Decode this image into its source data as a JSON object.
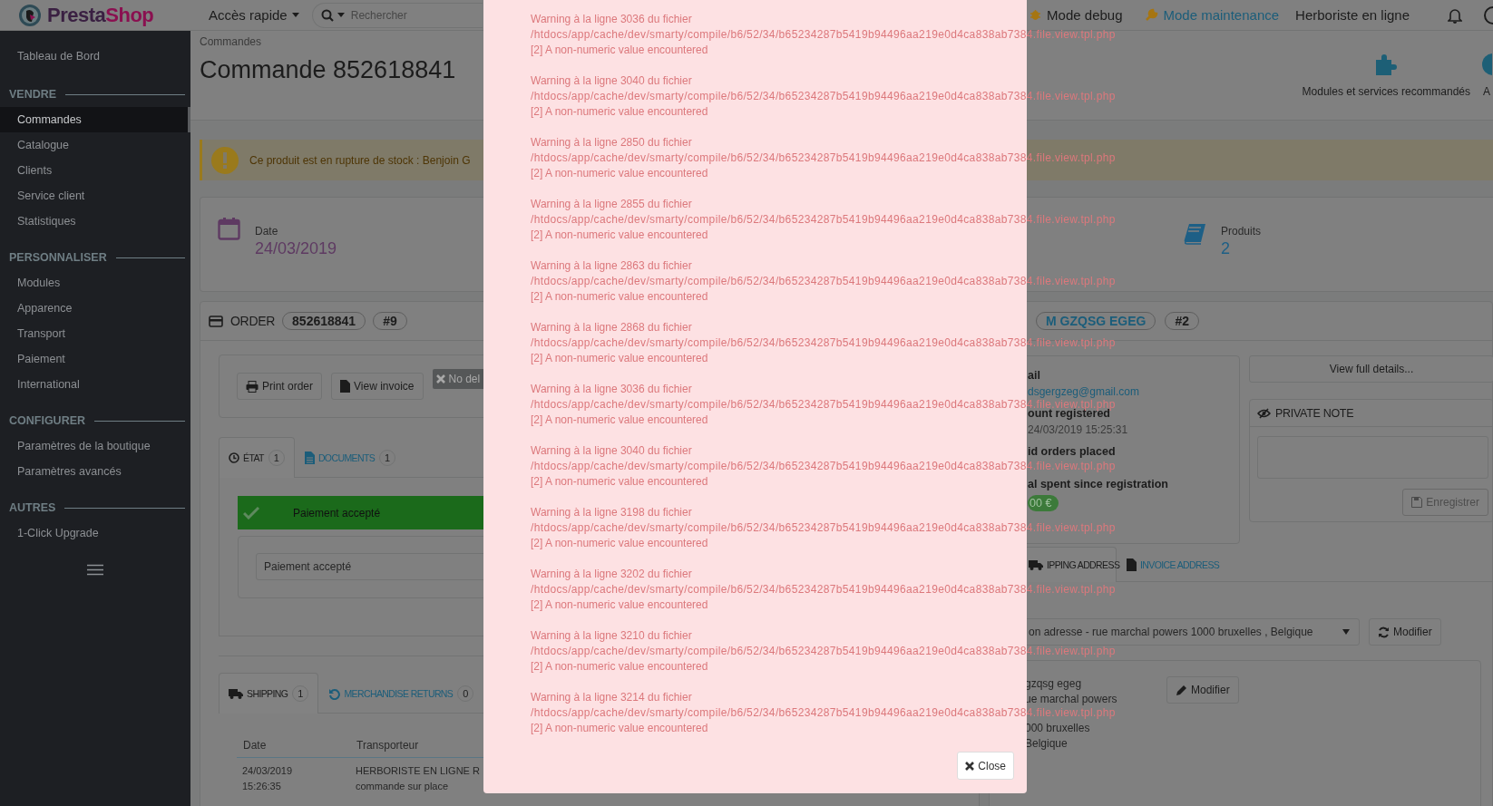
{
  "header": {
    "logo": [
      "Presta",
      "Shop"
    ],
    "quick_access": "Accès rapide",
    "search": {
      "placeholder": "Rechercher"
    },
    "debug": "Mode debug",
    "maintenance": "Mode maintenance",
    "shop": "Herboriste en ligne"
  },
  "sidebar": {
    "top_item": {
      "label": "Tableau de Bord",
      "selected": false
    },
    "sections": [
      {
        "title": "VENDRE",
        "items": [
          {
            "label": "Commandes",
            "selected": true
          },
          {
            "label": "Catalogue",
            "selected": false
          },
          {
            "label": "Clients",
            "selected": false
          },
          {
            "label": "Service client",
            "selected": false
          },
          {
            "label": "Statistiques",
            "selected": false
          }
        ]
      },
      {
        "title": "PERSONNALISER",
        "items": [
          {
            "label": "Modules",
            "selected": false
          },
          {
            "label": "Apparence",
            "selected": false
          },
          {
            "label": "Transport",
            "selected": false
          },
          {
            "label": "Paiement",
            "selected": false
          },
          {
            "label": "International",
            "selected": false
          }
        ]
      },
      {
        "title": "CONFIGURER",
        "items": [
          {
            "label": "Paramètres de la boutique",
            "selected": false
          },
          {
            "label": "Paramètres avancés",
            "selected": false
          }
        ]
      },
      {
        "title": "AUTRES",
        "items": [
          {
            "label": "1-Click Upgrade",
            "selected": false
          }
        ]
      }
    ]
  },
  "breadcrumb": "Commandes",
  "page_title": "Commande 852618841",
  "toolbar": {
    "action": "Modules et services recommandés",
    "action_2": "A"
  },
  "alert": "Ce produit est en rupture de stock : Benjoin G",
  "kpis": [
    {
      "kind": "date",
      "label": "Date",
      "value": "24/03/2019"
    },
    {
      "kind": "products",
      "label": "Produits",
      "value": "2"
    }
  ],
  "order_panel": {
    "title": "ORDER",
    "reference": "852618841",
    "number": "#9",
    "buttons": [
      {
        "kind": "print",
        "label": "Print order"
      },
      {
        "kind": "invoice",
        "label": "View invoice"
      },
      {
        "kind": "none",
        "label": "No del"
      }
    ],
    "status_tabs": [
      {
        "kind": "history",
        "label": "ÉTAT",
        "count": "1",
        "selected": true
      },
      {
        "kind": "documents",
        "label": "DOCUMENTS",
        "count": "1",
        "selected": false
      }
    ],
    "current_status": "Paiement accepté",
    "status_select": {
      "value": "Paiement accepté"
    },
    "shipping_tabs": [
      {
        "kind": "shipping",
        "label": "SHIPPING",
        "count": "1",
        "selected": true
      },
      {
        "kind": "returns",
        "label": "MERCHANDISE RETURNS",
        "count": "0",
        "selected": false
      }
    ],
    "shipping_table": {
      "columns": [
        "Date",
        "Transporteur"
      ],
      "rows": [
        [
          [
            "24/03/2019",
            "15:26:35"
          ],
          [
            "HERBORISTE EN LIGNE R",
            "commande sur place"
          ]
        ]
      ]
    }
  },
  "customer_panel": {
    "name": "M GZQSG EGEG",
    "number": "#2",
    "info": [
      {
        "kind": "link",
        "label": "ail",
        "value": "dsgergzeg@gmail.com"
      },
      {
        "kind": "text",
        "label": "ount registered",
        "value": "24/03/2019 15:25:31"
      },
      {
        "kind": "none",
        "label": "id orders placed"
      },
      {
        "kind": "badge",
        "label": "al spent since registration",
        "value": "00 €"
      }
    ],
    "details_button": "View full details...",
    "private_note": {
      "title": "PRIVATE NOTE",
      "save_button": {
        "label": "Enregistrer",
        "disabled": true
      }
    },
    "address_tabs": [
      {
        "kind": "shipping",
        "label": "IPPING ADDRESS",
        "selected": true
      },
      {
        "kind": "invoice",
        "label": "INVOICE ADDRESS",
        "selected": false
      }
    ],
    "address_select": {
      "value": "on adresse - rue marchal powers 1000 bruxelles , Belgique"
    },
    "refresh_button": "Modifier",
    "address_lines": [
      "gzqsg egeg",
      "ue marchal powers",
      "000 bruxelles",
      "Belgique"
    ],
    "edit_button": "Modifier"
  },
  "modal": {
    "warnings": [
      {
        "heading": "Warning à la ligne 3036 du fichier",
        "path": "/htdocs/app/cache/dev/smarty/compile/b6/52/34/b65234287b5419b94496aa219e0d4ca838ab7384.file.view.tpl.php",
        "message": "[2] A non-numeric value encountered"
      },
      {
        "heading": "Warning à la ligne 3040 du fichier",
        "path": "/htdocs/app/cache/dev/smarty/compile/b6/52/34/b65234287b5419b94496aa219e0d4ca838ab7384.file.view.tpl.php",
        "message": "[2] A non-numeric value encountered"
      },
      {
        "heading": "Warning à la ligne 2850 du fichier",
        "path": "/htdocs/app/cache/dev/smarty/compile/b6/52/34/b65234287b5419b94496aa219e0d4ca838ab7384.file.view.tpl.php",
        "message": "[2] A non-numeric value encountered"
      },
      {
        "heading": "Warning à la ligne 2855 du fichier",
        "path": "/htdocs/app/cache/dev/smarty/compile/b6/52/34/b65234287b5419b94496aa219e0d4ca838ab7384.file.view.tpl.php",
        "message": "[2] A non-numeric value encountered"
      },
      {
        "heading": "Warning à la ligne 2863 du fichier",
        "path": "/htdocs/app/cache/dev/smarty/compile/b6/52/34/b65234287b5419b94496aa219e0d4ca838ab7384.file.view.tpl.php",
        "message": "[2] A non-numeric value encountered"
      },
      {
        "heading": "Warning à la ligne 2868 du fichier",
        "path": "/htdocs/app/cache/dev/smarty/compile/b6/52/34/b65234287b5419b94496aa219e0d4ca838ab7384.file.view.tpl.php",
        "message": "[2] A non-numeric value encountered"
      },
      {
        "heading": "Warning à la ligne 3036 du fichier",
        "path": "/htdocs/app/cache/dev/smarty/compile/b6/52/34/b65234287b5419b94496aa219e0d4ca838ab7384.file.view.tpl.php",
        "message": "[2] A non-numeric value encountered"
      },
      {
        "heading": "Warning à la ligne 3040 du fichier",
        "path": "/htdocs/app/cache/dev/smarty/compile/b6/52/34/b65234287b5419b94496aa219e0d4ca838ab7384.file.view.tpl.php",
        "message": "[2] A non-numeric value encountered"
      },
      {
        "heading": "Warning à la ligne 3198 du fichier",
        "path": "/htdocs/app/cache/dev/smarty/compile/b6/52/34/b65234287b5419b94496aa219e0d4ca838ab7384.file.view.tpl.php",
        "message": "[2] A non-numeric value encountered"
      },
      {
        "heading": "Warning à la ligne 3202 du fichier",
        "path": "/htdocs/app/cache/dev/smarty/compile/b6/52/34/b65234287b5419b94496aa219e0d4ca838ab7384.file.view.tpl.php",
        "message": "[2] A non-numeric value encountered"
      },
      {
        "heading": "Warning à la ligne 3210 du fichier",
        "path": "/htdocs/app/cache/dev/smarty/compile/b6/52/34/b65234287b5419b94496aa219e0d4ca838ab7384.file.view.tpl.php",
        "message": "[2] A non-numeric value encountered"
      },
      {
        "heading": "Warning à la ligne 3214 du fichier",
        "path": "/htdocs/app/cache/dev/smarty/compile/b6/52/34/b65234287b5419b94496aa219e0d4ca838ab7384.file.view.tpl.php",
        "message": "[2] A non-numeric value encountered"
      }
    ],
    "close_button": "Close"
  }
}
